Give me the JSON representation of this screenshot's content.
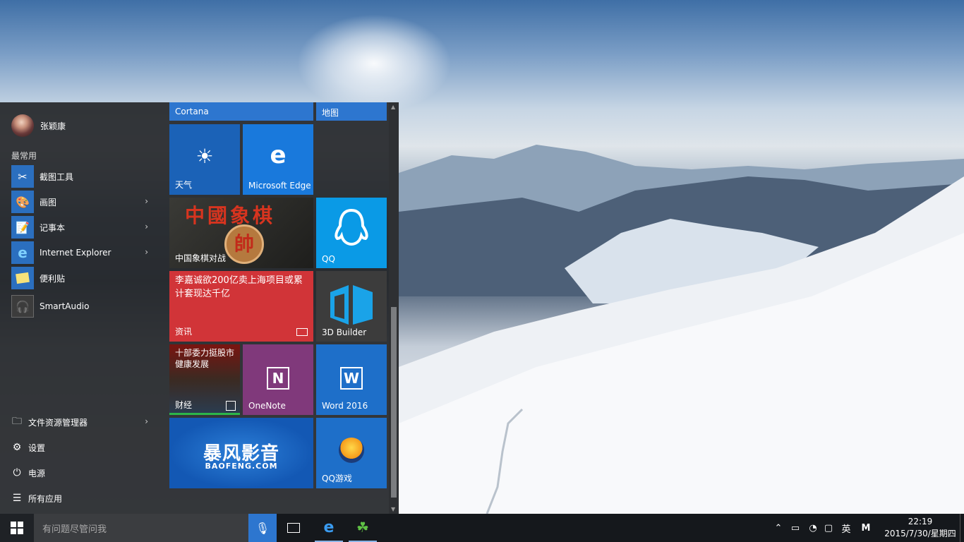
{
  "user": {
    "name": "张颖康"
  },
  "start": {
    "most_used_label": "最常用",
    "apps": [
      {
        "label": "截图工具",
        "icon": "snipping-tool-icon"
      },
      {
        "label": "画图",
        "icon": "paint-icon",
        "submenu": true
      },
      {
        "label": "记事本",
        "icon": "notepad-icon",
        "submenu": true
      },
      {
        "label": "Internet Explorer",
        "icon": "internet-explorer-icon",
        "submenu": true
      },
      {
        "label": "便利贴",
        "icon": "sticky-notes-icon"
      },
      {
        "label": "SmartAudio",
        "icon": "smartaudio-icon"
      }
    ],
    "system": [
      {
        "label": "文件资源管理器",
        "icon": "file-explorer-icon",
        "submenu": true
      },
      {
        "label": "设置",
        "icon": "gear-icon"
      },
      {
        "label": "电源",
        "icon": "power-icon"
      },
      {
        "label": "所有应用",
        "icon": "all-apps-icon"
      }
    ]
  },
  "tiles": {
    "cortana": "Cortana",
    "maps": "地图",
    "weather": "天气",
    "edge": "Microsoft Edge",
    "chess": "中国象棋对战",
    "chess_banner": "中國象棋",
    "chess_piece": "帥",
    "qq": "QQ",
    "news_headline": "李嘉诚欲200亿卖上海项目或累计套现达千亿",
    "news": "资讯",
    "builder": "3D Builder",
    "finance_headline": "十部委力挺股市健康发展",
    "finance": "财经",
    "onenote": "OneNote",
    "word": "Word 2016",
    "baofeng_cn": "暴风影音",
    "baofeng_en": "BAOFENG.COM",
    "qqgame": "QQ游戏"
  },
  "taskbar": {
    "search_placeholder": "有问题尽管问我",
    "ime": "英",
    "time": "22:19",
    "date": "2015/7/30/星期四"
  },
  "colors": {
    "accent": "#2d76cf",
    "tile_blue": "#1e6fc9",
    "news_red": "#d13438",
    "onenote_purple": "#80397b",
    "qq_blue": "#0a9ae6"
  }
}
